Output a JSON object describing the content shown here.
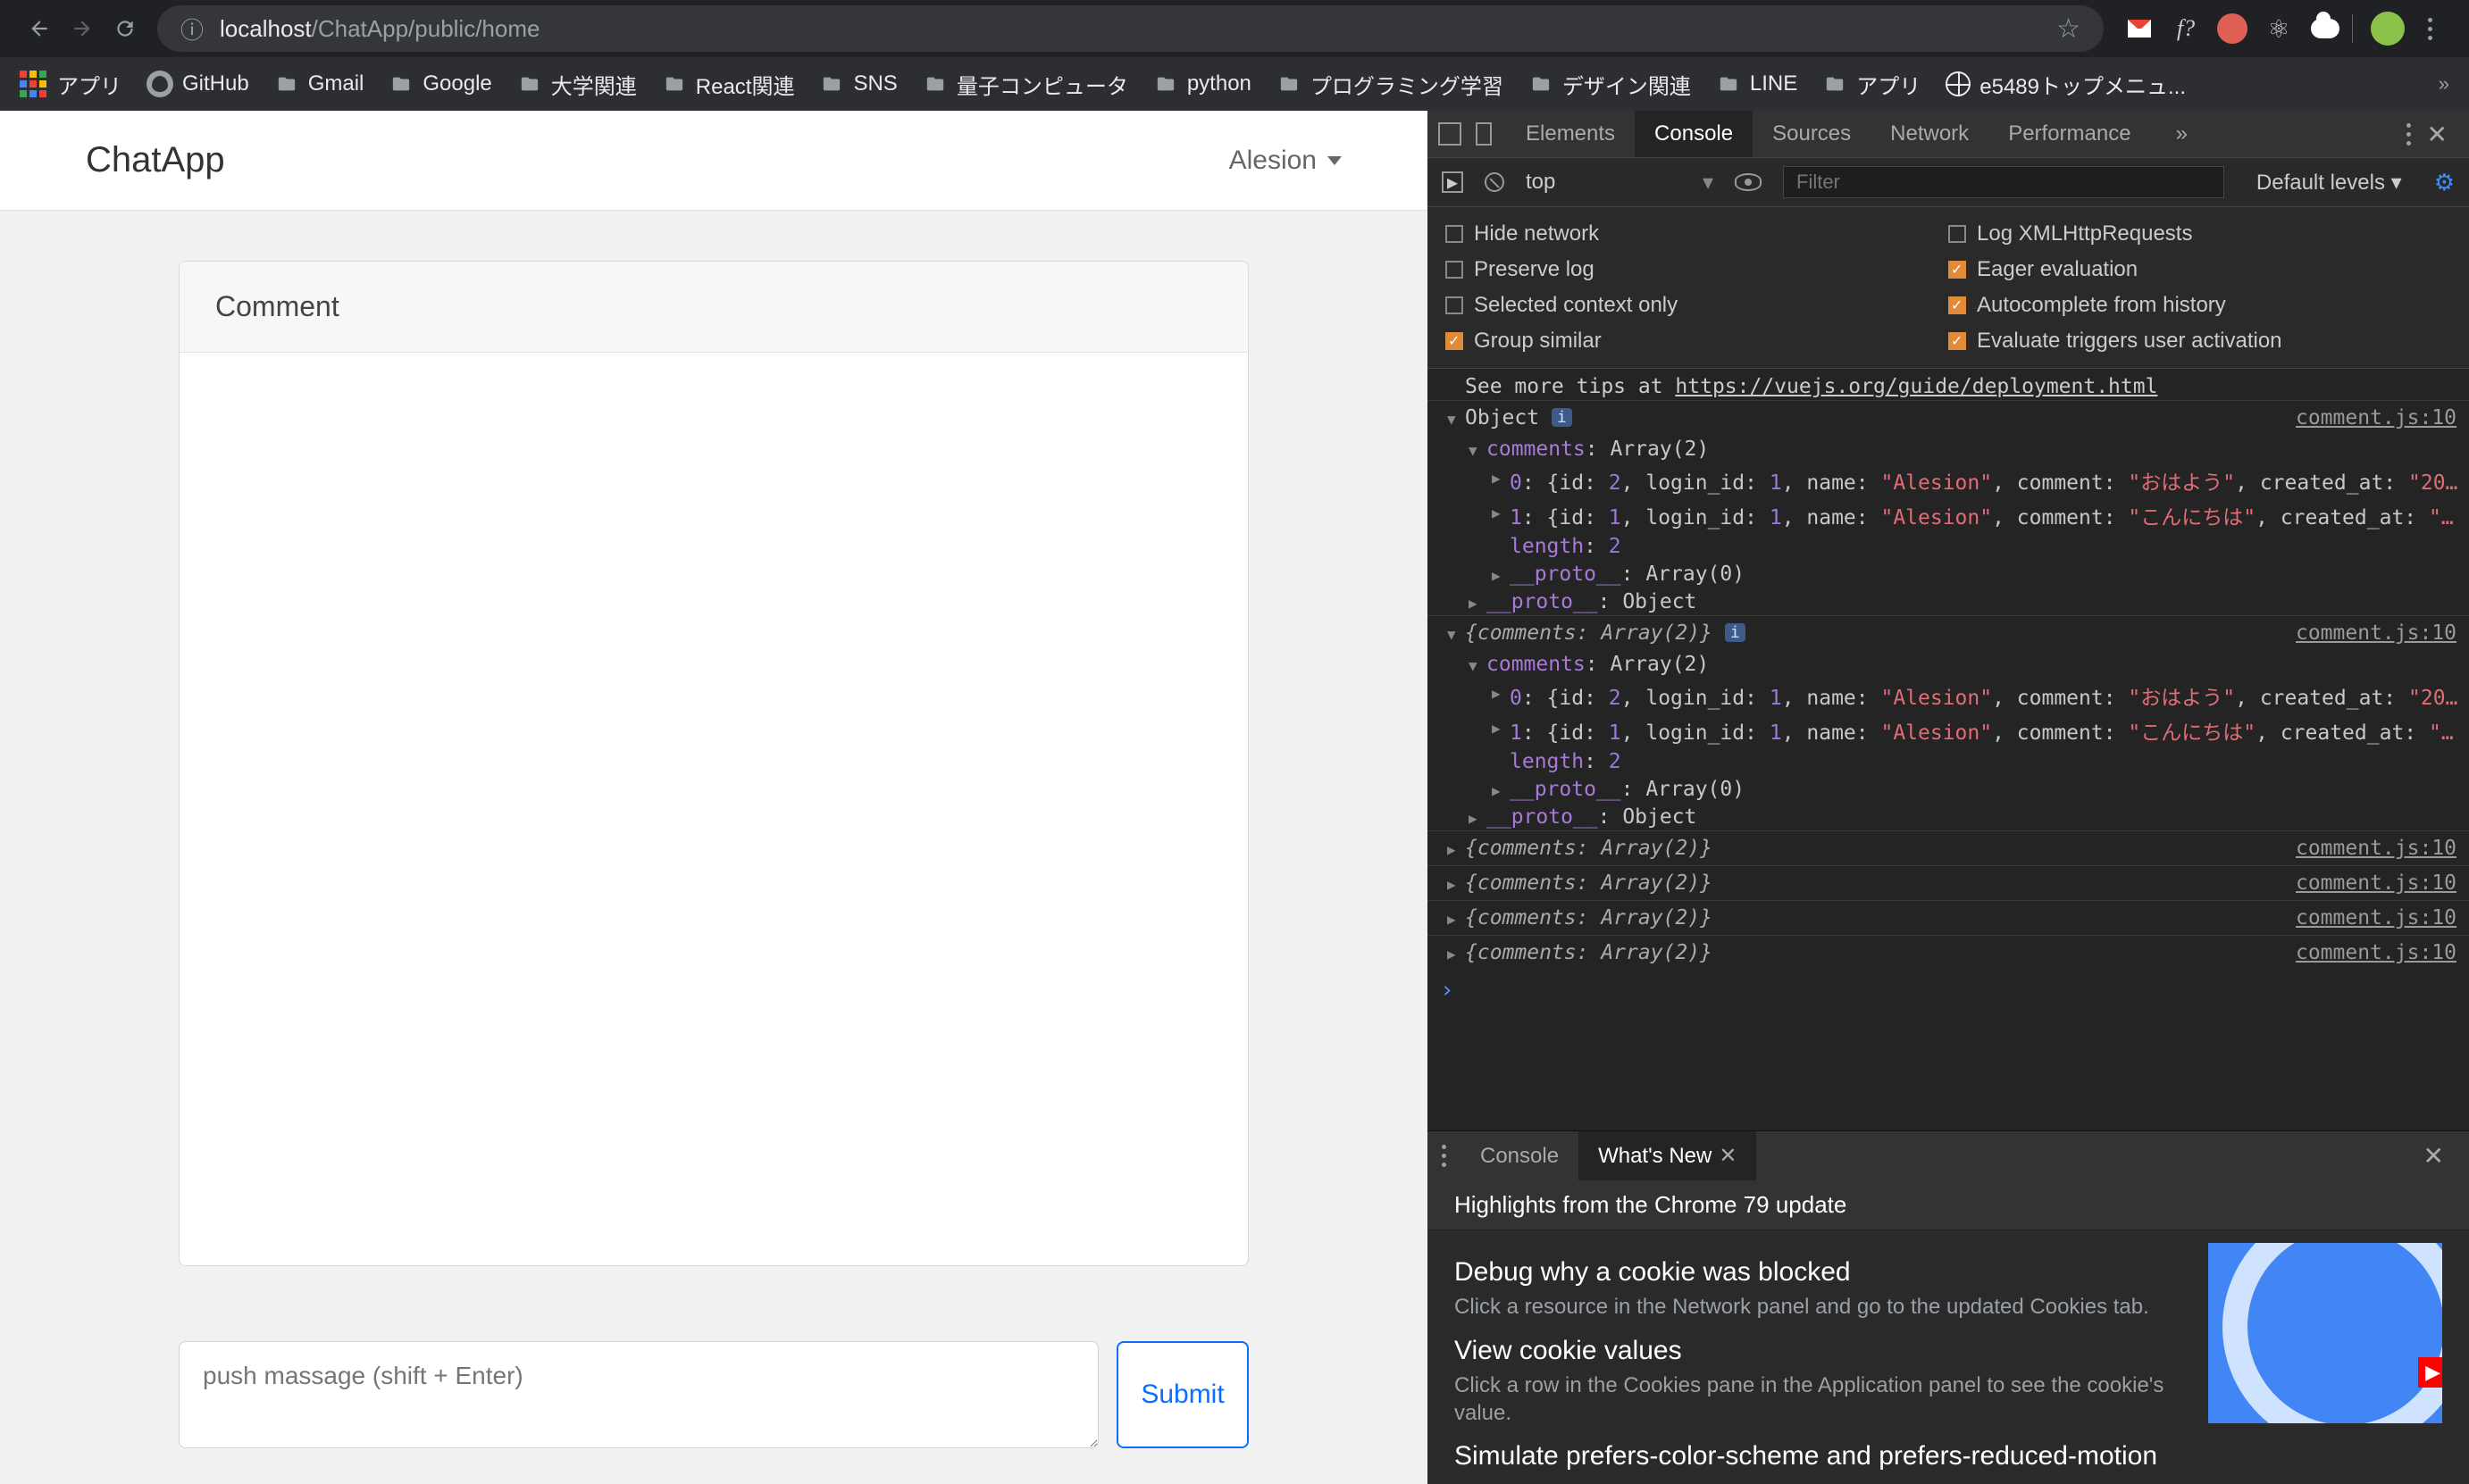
{
  "browser": {
    "url_prefix": "localhost",
    "url_path": "/ChatApp/public/home",
    "info_glyph": "ⓘ"
  },
  "bookmarks": {
    "apps": "アプリ",
    "items": [
      {
        "type": "github",
        "label": "GitHub"
      },
      {
        "type": "folder",
        "label": "Gmail"
      },
      {
        "type": "folder",
        "label": "Google"
      },
      {
        "type": "folder",
        "label": "大学関連"
      },
      {
        "type": "folder",
        "label": "React関連"
      },
      {
        "type": "folder",
        "label": "SNS"
      },
      {
        "type": "folder",
        "label": "量子コンピュータ"
      },
      {
        "type": "folder",
        "label": "python"
      },
      {
        "type": "folder",
        "label": "プログラミング学習"
      },
      {
        "type": "folder",
        "label": "デザイン関連"
      },
      {
        "type": "folder",
        "label": "LINE"
      },
      {
        "type": "folder",
        "label": "アプリ"
      },
      {
        "type": "globe",
        "label": "e5489トップメニュ..."
      }
    ],
    "overflow": "»"
  },
  "app": {
    "brand": "ChatApp",
    "user": "Alesion",
    "card_title": "Comment",
    "placeholder": "push massage (shift + Enter)",
    "submit": "Submit"
  },
  "devtools": {
    "tabs": [
      "Elements",
      "Console",
      "Sources",
      "Network",
      "Performance"
    ],
    "active_tab": "Console",
    "more": "»",
    "context": "top",
    "filter_placeholder": "Filter",
    "levels": "Default levels ▾",
    "options": {
      "hide_network": {
        "label": "Hide network",
        "on": false
      },
      "log_xhr": {
        "label": "Log XMLHttpRequests",
        "on": false
      },
      "preserve_log": {
        "label": "Preserve log",
        "on": false
      },
      "eager_eval": {
        "label": "Eager evaluation",
        "on": true
      },
      "sel_context": {
        "label": "Selected context only",
        "on": false
      },
      "auto_hist": {
        "label": "Autocomplete from history",
        "on": true
      },
      "group_similar": {
        "label": "Group similar",
        "on": true
      },
      "eval_trigger": {
        "label": "Evaluate triggers user activation",
        "on": true
      }
    },
    "tip_prefix": "See more tips at ",
    "tip_url": "https://vuejs.org/guide/deployment.html",
    "source": "comment.js:10",
    "obj_label": "Object",
    "comments_arr": "comments: Array(2)",
    "row0a": "0: {id: 2, login_id: 1, name: \"Alesion\", comment: \"おはよう\", created_at: \"20…",
    "row1a": "1: {id: 1, login_id: 1, name: \"Alesion\", comment: \"こんにちは\", created_at: \"…",
    "length": "length: 2",
    "proto_arr": "__proto__: Array(0)",
    "proto_obj": "__proto__: Object",
    "obj_inline": "{comments: Array(2)}",
    "row0b": "0: {id: 2, login_id: 1, name: \"Alesion\", comment: \"おはよう\", created_at: \"20…",
    "row1b": "1: {id: 1, login_id: 1, name: \"Alesion\", comment: \"こんにちは\", created_at: \"…",
    "collapsed": "{comments: Array(2)}",
    "prompt": "›"
  },
  "drawer": {
    "tabs": [
      "Console",
      "What's New"
    ],
    "active": "What's New",
    "headline": "Highlights from the Chrome 79 update",
    "s1_title": "Debug why a cookie was blocked",
    "s1_body": "Click a resource in the Network panel and go to the updated Cookies tab.",
    "s2_title": "View cookie values",
    "s2_body": "Click a row in the Cookies pane in the Application panel to see the cookie's value.",
    "s3_title": "Simulate prefers-color-scheme and prefers-reduced-motion"
  }
}
